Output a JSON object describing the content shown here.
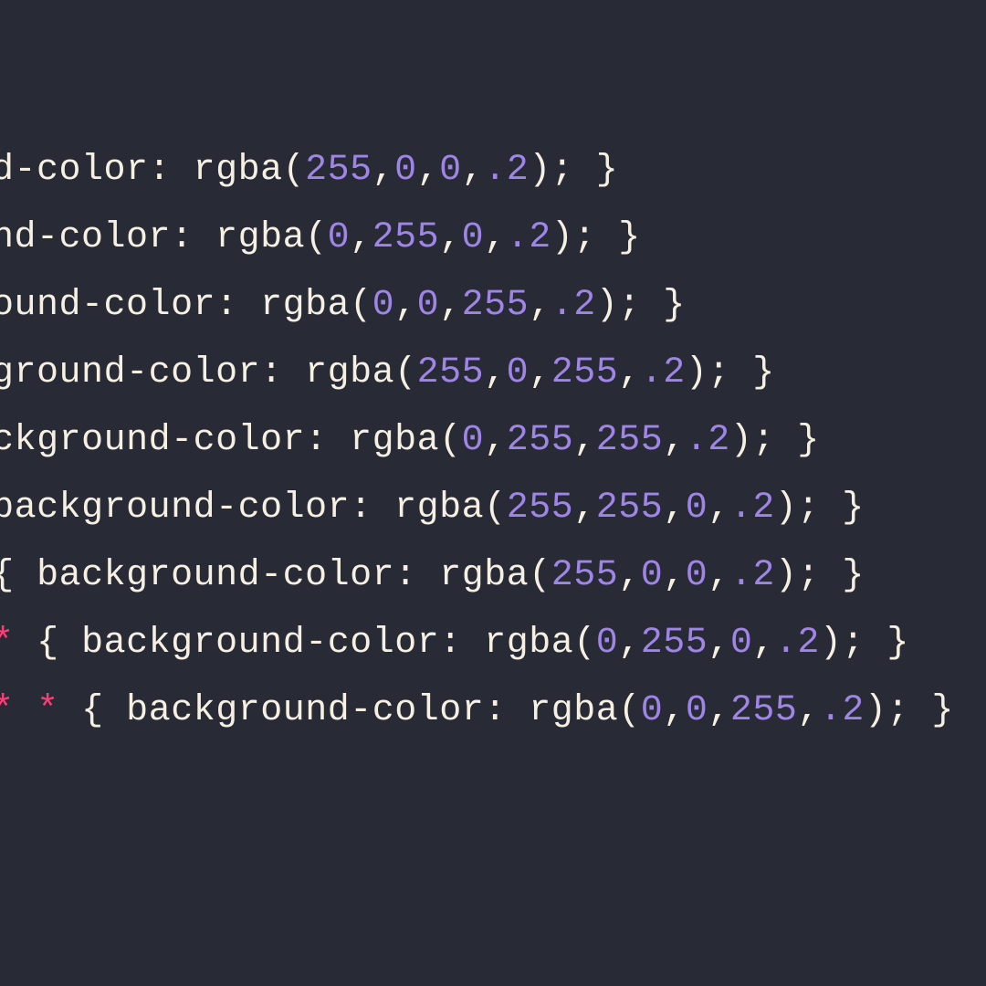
{
  "colors": {
    "background": "#282a36",
    "text": "#f5f0e1",
    "number": "#9f85e6",
    "star": "#ff3d74"
  },
  "code": {
    "lines": [
      [
        {
          "cls": "tok-text",
          "t": "ackground-color: rgba("
        },
        {
          "cls": "tok-num",
          "t": "255"
        },
        {
          "cls": "tok-text",
          "t": ","
        },
        {
          "cls": "tok-num",
          "t": "0"
        },
        {
          "cls": "tok-text",
          "t": ","
        },
        {
          "cls": "tok-num",
          "t": "0"
        },
        {
          "cls": "tok-text",
          "t": ","
        },
        {
          "cls": "tok-num",
          "t": ".2"
        },
        {
          "cls": "tok-text",
          "t": "); }"
        }
      ],
      [
        {
          "cls": "tok-text",
          "t": "background-color: rgba("
        },
        {
          "cls": "tok-num",
          "t": "0"
        },
        {
          "cls": "tok-text",
          "t": ","
        },
        {
          "cls": "tok-num",
          "t": "255"
        },
        {
          "cls": "tok-text",
          "t": ","
        },
        {
          "cls": "tok-num",
          "t": "0"
        },
        {
          "cls": "tok-text",
          "t": ","
        },
        {
          "cls": "tok-num",
          "t": ".2"
        },
        {
          "cls": "tok-text",
          "t": "); }"
        }
      ],
      [
        {
          "cls": "tok-text",
          "t": "{ background-color: rgba("
        },
        {
          "cls": "tok-num",
          "t": "0"
        },
        {
          "cls": "tok-text",
          "t": ","
        },
        {
          "cls": "tok-num",
          "t": "0"
        },
        {
          "cls": "tok-text",
          "t": ","
        },
        {
          "cls": "tok-num",
          "t": "255"
        },
        {
          "cls": "tok-text",
          "t": ","
        },
        {
          "cls": "tok-num",
          "t": ".2"
        },
        {
          "cls": "tok-text",
          "t": "); }"
        }
      ],
      [
        {
          "cls": "tok-star",
          "t": "*"
        },
        {
          "cls": "tok-text",
          "t": " { background-color: rgba("
        },
        {
          "cls": "tok-num",
          "t": "255"
        },
        {
          "cls": "tok-text",
          "t": ","
        },
        {
          "cls": "tok-num",
          "t": "0"
        },
        {
          "cls": "tok-text",
          "t": ","
        },
        {
          "cls": "tok-num",
          "t": "255"
        },
        {
          "cls": "tok-text",
          "t": ","
        },
        {
          "cls": "tok-num",
          "t": ".2"
        },
        {
          "cls": "tok-text",
          "t": "); }"
        }
      ],
      [
        {
          "cls": "tok-star",
          "t": "*"
        },
        {
          "cls": "tok-text",
          "t": " "
        },
        {
          "cls": "tok-star",
          "t": "*"
        },
        {
          "cls": "tok-text",
          "t": " { background-color: rgba("
        },
        {
          "cls": "tok-num",
          "t": "0"
        },
        {
          "cls": "tok-text",
          "t": ","
        },
        {
          "cls": "tok-num",
          "t": "255"
        },
        {
          "cls": "tok-text",
          "t": ","
        },
        {
          "cls": "tok-num",
          "t": "255"
        },
        {
          "cls": "tok-text",
          "t": ","
        },
        {
          "cls": "tok-num",
          "t": ".2"
        },
        {
          "cls": "tok-text",
          "t": "); }"
        }
      ],
      [
        {
          "cls": "tok-star",
          "t": "*"
        },
        {
          "cls": "tok-text",
          "t": " "
        },
        {
          "cls": "tok-star",
          "t": "*"
        },
        {
          "cls": "tok-text",
          "t": " "
        },
        {
          "cls": "tok-star",
          "t": "*"
        },
        {
          "cls": "tok-text",
          "t": " { background-color: rgba("
        },
        {
          "cls": "tok-num",
          "t": "255"
        },
        {
          "cls": "tok-text",
          "t": ","
        },
        {
          "cls": "tok-num",
          "t": "255"
        },
        {
          "cls": "tok-text",
          "t": ","
        },
        {
          "cls": "tok-num",
          "t": "0"
        },
        {
          "cls": "tok-text",
          "t": ","
        },
        {
          "cls": "tok-num",
          "t": ".2"
        },
        {
          "cls": "tok-text",
          "t": "); }"
        }
      ],
      [
        {
          "cls": "tok-star",
          "t": "*"
        },
        {
          "cls": "tok-text",
          "t": " "
        },
        {
          "cls": "tok-star",
          "t": "*"
        },
        {
          "cls": "tok-text",
          "t": " "
        },
        {
          "cls": "tok-star",
          "t": "*"
        },
        {
          "cls": "tok-text",
          "t": " "
        },
        {
          "cls": "tok-star",
          "t": "*"
        },
        {
          "cls": "tok-text",
          "t": " { background-color: rgba("
        },
        {
          "cls": "tok-num",
          "t": "255"
        },
        {
          "cls": "tok-text",
          "t": ","
        },
        {
          "cls": "tok-num",
          "t": "0"
        },
        {
          "cls": "tok-text",
          "t": ","
        },
        {
          "cls": "tok-num",
          "t": "0"
        },
        {
          "cls": "tok-text",
          "t": ","
        },
        {
          "cls": "tok-num",
          "t": ".2"
        },
        {
          "cls": "tok-text",
          "t": "); }"
        }
      ],
      [
        {
          "cls": "tok-star",
          "t": "*"
        },
        {
          "cls": "tok-text",
          "t": " "
        },
        {
          "cls": "tok-star",
          "t": "*"
        },
        {
          "cls": "tok-text",
          "t": " "
        },
        {
          "cls": "tok-star",
          "t": "*"
        },
        {
          "cls": "tok-text",
          "t": " "
        },
        {
          "cls": "tok-star",
          "t": "*"
        },
        {
          "cls": "tok-text",
          "t": " "
        },
        {
          "cls": "tok-star",
          "t": "*"
        },
        {
          "cls": "tok-text",
          "t": " { background-color: rgba("
        },
        {
          "cls": "tok-num",
          "t": "0"
        },
        {
          "cls": "tok-text",
          "t": ","
        },
        {
          "cls": "tok-num",
          "t": "255"
        },
        {
          "cls": "tok-text",
          "t": ","
        },
        {
          "cls": "tok-num",
          "t": "0"
        },
        {
          "cls": "tok-text",
          "t": ","
        },
        {
          "cls": "tok-num",
          "t": ".2"
        },
        {
          "cls": "tok-text",
          "t": "); }"
        }
      ],
      [
        {
          "cls": "tok-star",
          "t": "*"
        },
        {
          "cls": "tok-text",
          "t": " "
        },
        {
          "cls": "tok-star",
          "t": "*"
        },
        {
          "cls": "tok-text",
          "t": " "
        },
        {
          "cls": "tok-star",
          "t": "*"
        },
        {
          "cls": "tok-text",
          "t": " "
        },
        {
          "cls": "tok-star",
          "t": "*"
        },
        {
          "cls": "tok-text",
          "t": " "
        },
        {
          "cls": "tok-star",
          "t": "*"
        },
        {
          "cls": "tok-text",
          "t": " "
        },
        {
          "cls": "tok-star",
          "t": "*"
        },
        {
          "cls": "tok-text",
          "t": " { background-color: rgba("
        },
        {
          "cls": "tok-num",
          "t": "0"
        },
        {
          "cls": "tok-text",
          "t": ","
        },
        {
          "cls": "tok-num",
          "t": "0"
        },
        {
          "cls": "tok-text",
          "t": ","
        },
        {
          "cls": "tok-num",
          "t": "255"
        },
        {
          "cls": "tok-text",
          "t": ","
        },
        {
          "cls": "tok-num",
          "t": ".2"
        },
        {
          "cls": "tok-text",
          "t": "); }"
        }
      ]
    ]
  }
}
